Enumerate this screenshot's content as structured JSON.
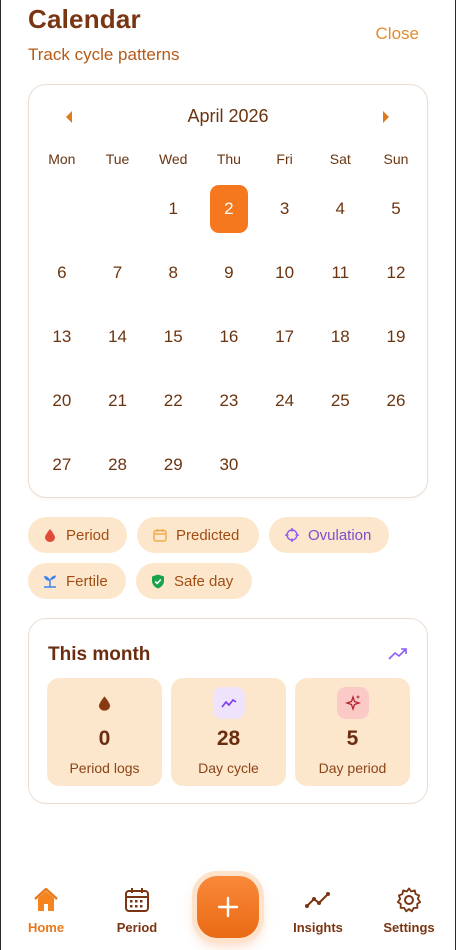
{
  "header": {
    "title": "Calendar",
    "subtitle": "Track cycle patterns",
    "close_label": "Close"
  },
  "calendar": {
    "month_label": "April 2026",
    "prev_icon": "chevron-left-icon",
    "next_icon": "chevron-right-icon",
    "weekdays": [
      "Mon",
      "Tue",
      "Wed",
      "Thu",
      "Fri",
      "Sat",
      "Sun"
    ],
    "days": [
      "",
      "",
      "1",
      "2",
      "3",
      "4",
      "5",
      "6",
      "7",
      "8",
      "9",
      "10",
      "11",
      "12",
      "13",
      "14",
      "15",
      "16",
      "17",
      "18",
      "19",
      "20",
      "21",
      "22",
      "23",
      "24",
      "25",
      "26",
      "27",
      "28",
      "29",
      "30"
    ],
    "selected_day": "2",
    "accent_color": "#f5781e"
  },
  "legend": [
    {
      "label": "Period",
      "icon": "drop-icon",
      "color": "#e04a3a"
    },
    {
      "label": "Predicted",
      "icon": "calendar-icon",
      "color": "#f0a94a"
    },
    {
      "label": "Ovulation",
      "icon": "target-icon",
      "color": "#8b5cf6"
    },
    {
      "label": "Fertile",
      "icon": "sprout-icon",
      "color": "#3b82f6"
    },
    {
      "label": "Safe day",
      "icon": "shield-check-icon",
      "color": "#16a34a"
    }
  ],
  "this_month": {
    "title": "This month",
    "trend_icon": "trending-up-icon",
    "stats": [
      {
        "value": "0",
        "label": "Period logs",
        "icon": "drop-icon"
      },
      {
        "value": "28",
        "label": "Day cycle",
        "icon": "activity-icon"
      },
      {
        "value": "5",
        "label": "Day period",
        "icon": "sparkles-icon"
      }
    ]
  },
  "bottom_nav": {
    "items": [
      {
        "label": "Home",
        "icon": "home-icon"
      },
      {
        "label": "Period",
        "icon": "calendar-icon"
      },
      {
        "label": "Insights",
        "icon": "trending-up-icon"
      },
      {
        "label": "Settings",
        "icon": "gear-icon"
      }
    ],
    "active": "Home",
    "fab_icon": "plus-icon"
  }
}
